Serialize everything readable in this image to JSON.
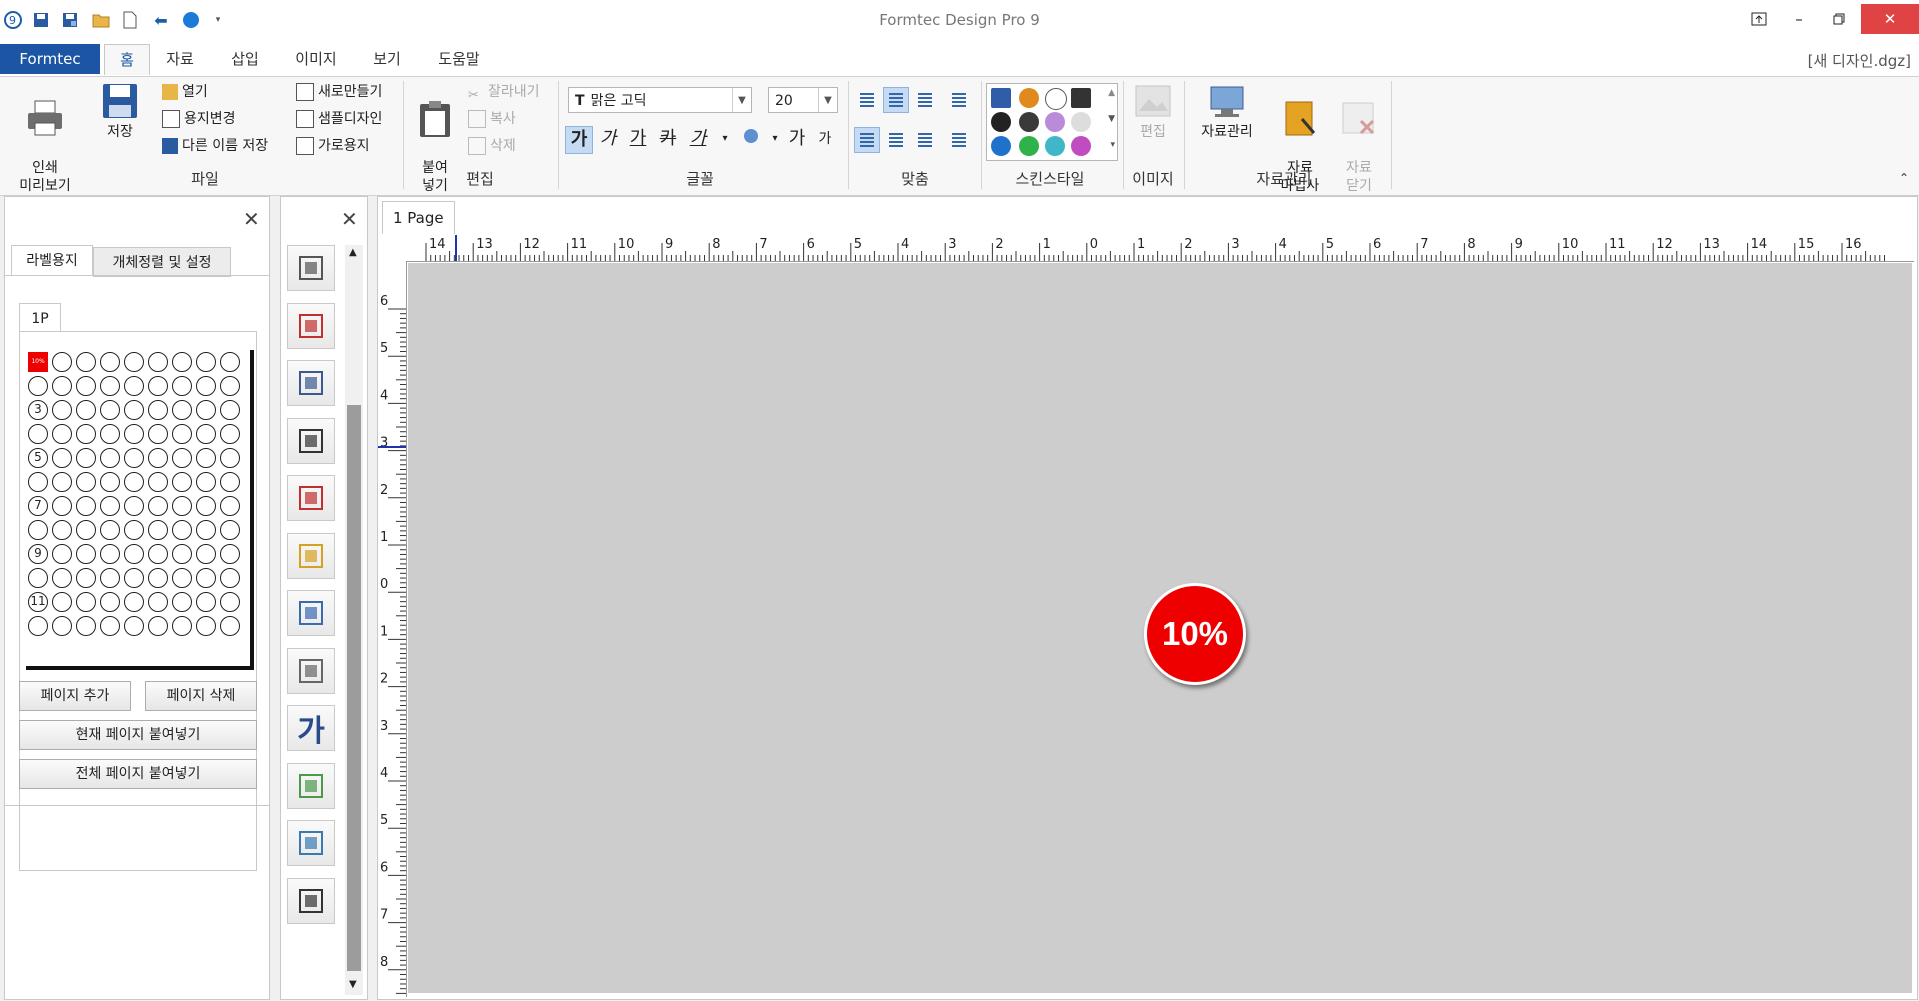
{
  "window": {
    "title": "Formtec Design Pro 9",
    "file_name": "[새 디자인.dgz]"
  },
  "ribbon_tabs": [
    "Formtec",
    "홈",
    "자료",
    "삽입",
    "이미지",
    "보기",
    "도움말"
  ],
  "ribbon": {
    "file": {
      "print_preview": "인쇄\n미리보기",
      "save": "저장",
      "open": "열기",
      "change_paper": "용지변경",
      "save_as": "다른 이름 저장",
      "new": "새로만들기",
      "sample": "샘플디자인",
      "landscape": "가로용지",
      "group": "파일"
    },
    "edit": {
      "paste": "붙여\n넣기",
      "cut": "잘라내기",
      "copy": "복사",
      "delete": "삭제",
      "group": "편집"
    },
    "font": {
      "name": "맑은 고딕",
      "size": "20",
      "group": "글꼴",
      "styles": [
        "가",
        "가",
        "가",
        "카",
        "가"
      ],
      "grow": "가",
      "shrink": "가"
    },
    "align": {
      "group": "맞춤"
    },
    "skin": {
      "group": "스킨스타일"
    },
    "image": {
      "edit": "편집",
      "group": "이미지"
    },
    "data": {
      "manage": "자료관리",
      "wizard": "자료\n마법사",
      "close": "자료\n닫기",
      "group": "자료관리"
    }
  },
  "left_panel": {
    "tabs": [
      "라벨용지",
      "개체정렬 및 설정"
    ],
    "subtab": "1P",
    "thumb_badge": "10%",
    "row_numbers": [
      "3",
      "5",
      "7",
      "9",
      "11"
    ],
    "buttons": {
      "add_page": "페이지 추가",
      "delete_page": "페이지 삭제",
      "paste_current": "현재 페이지 붙여넣기",
      "paste_all": "전체 페이지 붙여넣기"
    }
  },
  "toolbox": {
    "tools": [
      "text-art-icon",
      "text-edit-icon",
      "qrcode-icon",
      "barcode-icon",
      "barcode-serial-icon",
      "stamp-icon",
      "table-icon",
      "document-icon",
      "big-text-icon",
      "picture-icon",
      "image-icon",
      "disc-icon"
    ],
    "big_text_glyph": "가"
  },
  "canvas": {
    "page_tab": "1 Page",
    "badge_text": "10%",
    "top_ruler_labels": [
      "14",
      "13",
      "12",
      "11",
      "10",
      "9",
      "8",
      "7",
      "6",
      "5",
      "4",
      "3",
      "2",
      "1",
      "0",
      "1",
      "2",
      "3",
      "4",
      "5",
      "6",
      "7",
      "8",
      "9",
      "10",
      "11",
      "12",
      "13",
      "14",
      "15",
      "16"
    ],
    "left_ruler_labels": [
      "6",
      "5",
      "4",
      "3",
      "2",
      "1",
      "0",
      "1",
      "2",
      "3",
      "4",
      "5",
      "6",
      "7",
      "8"
    ]
  },
  "colors": {
    "accent": "#1b55a3",
    "badge": "#ee0000",
    "canvas_bg": "#cdcdcd"
  }
}
